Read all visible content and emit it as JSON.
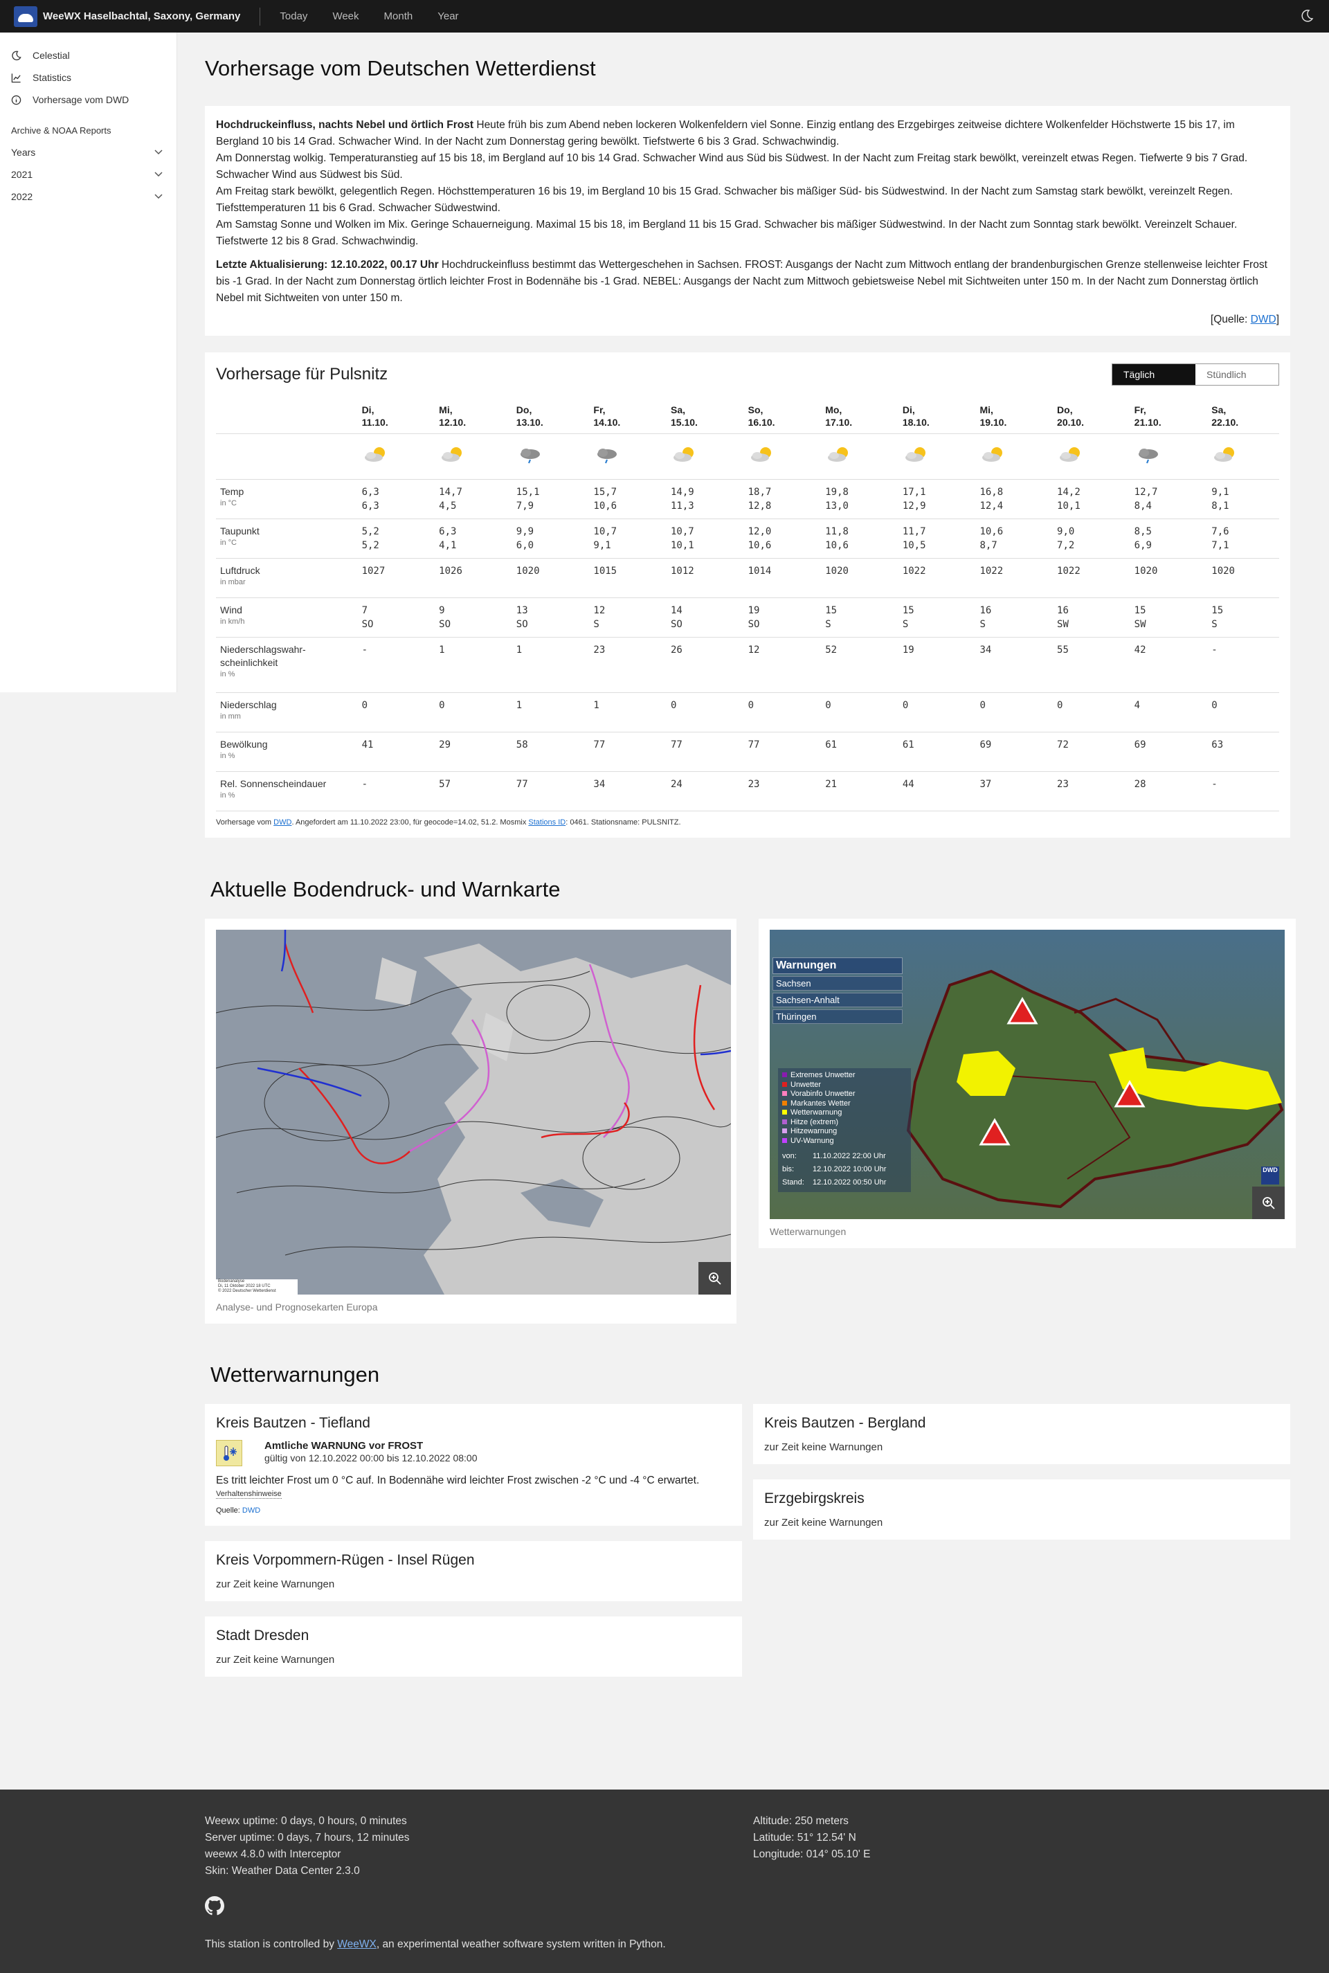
{
  "header": {
    "brand_prefix": "WeeWX",
    "brand_rest": "Haselbachtal, Saxony, Germany",
    "nav": [
      "Today",
      "Week",
      "Month",
      "Year"
    ]
  },
  "sidebar": {
    "items": [
      "Celestial",
      "Statistics",
      "Vorhersage vom DWD"
    ],
    "section": "Archive & NOAA Reports",
    "folds": [
      "Years",
      "2021",
      "2022"
    ]
  },
  "page_title": "Vorhersage vom Deutschen Wetterdienst",
  "text": {
    "lead1_bold": "Hochdruckeinfluss, nachts Nebel und örtlich Frost",
    "lead1": " Heute früh bis zum Abend neben lockeren Wolkenfeldern viel Sonne. Einzig entlang des Erzgebirges zeitweise dichtere Wolkenfelder Höchstwerte 15 bis 17, im Bergland 10 bis 14 Grad. Schwacher Wind. In der Nacht zum Donnerstag gering bewölkt. Tiefstwerte 6 bis 3 Grad. Schwachwindig.",
    "p2": "Am Donnerstag wolkig. Temperaturanstieg auf 15 bis 18, im Bergland auf 10 bis 14 Grad. Schwacher Wind aus Süd bis Südwest. In der Nacht zum Freitag stark bewölkt, vereinzelt etwas Regen. Tiefwerte 9 bis 7 Grad. Schwacher Wind aus Südwest bis Süd.",
    "p3": "Am Freitag stark bewölkt, gelegentlich Regen. Höchsttemperaturen 16 bis 19, im Bergland 10 bis 15 Grad. Schwacher bis mäßiger Süd- bis Südwestwind. In der Nacht zum Samstag stark bewölkt, vereinzelt Regen. Tiefsttemperaturen 11 bis 6 Grad. Schwacher Südwestwind.",
    "p4": "Am Samstag Sonne und Wolken im Mix. Geringe Schauerneigung. Maximal 15 bis 18, im Bergland 11 bis 15 Grad. Schwacher bis mäßiger Südwestwind. In der Nacht zum Sonntag stark bewölkt. Vereinzelt Schauer. Tiefstwerte 12 bis 8 Grad. Schwachwindig.",
    "lead2_bold": "Letzte Aktualisierung: 12.10.2022, 00.17 Uhr",
    "lead2": " Hochdruckeinfluss bestimmt das Wettergeschehen in Sachsen. FROST: Ausgangs der Nacht zum Mittwoch entlang der brandenburgischen Grenze stellenweise leichter Frost bis -1 Grad. In der Nacht zum Donnerstag örtlich leichter Frost in Bodennähe bis -1 Grad. NEBEL: Ausgangs der Nacht zum Mittwoch gebietsweise Nebel mit Sichtweiten unter 150 m. In der Nacht zum Donnerstag örtlich Nebel mit Sichtweiten von unter 150 m.",
    "source_pre": "[Quelle: ",
    "source_link": "DWD",
    "source_post": "]"
  },
  "forecast": {
    "title": "Vorhersage für Pulsnitz",
    "toggle": [
      "Täglich",
      "Stündlich"
    ],
    "days": [
      [
        "Di,",
        "11.10."
      ],
      [
        "Mi,",
        "12.10."
      ],
      [
        "Do,",
        "13.10."
      ],
      [
        "Fr,",
        "14.10."
      ],
      [
        "Sa,",
        "15.10."
      ],
      [
        "So,",
        "16.10."
      ],
      [
        "Mo,",
        "17.10."
      ],
      [
        "Di,",
        "18.10."
      ],
      [
        "Mi,",
        "19.10."
      ],
      [
        "Do,",
        "20.10."
      ],
      [
        "Fr,",
        "21.10."
      ],
      [
        "Sa,",
        "22.10."
      ]
    ],
    "icons": [
      "partly-cloudy",
      "partly-cloudy",
      "rain-cloud",
      "rain-cloud",
      "partly-cloudy",
      "partly-cloudy",
      "partly-cloudy",
      "partly-cloudy",
      "partly-cloudy",
      "partly-cloudy",
      "rain-cloud",
      "partly-cloudy"
    ],
    "rows": [
      {
        "label": "Temp",
        "unit": "in °C",
        "v": [
          [
            "6,3",
            "6,3"
          ],
          [
            "14,7",
            "4,5"
          ],
          [
            "15,1",
            "7,9"
          ],
          [
            "15,7",
            "10,6"
          ],
          [
            "14,9",
            "11,3"
          ],
          [
            "18,7",
            "12,8"
          ],
          [
            "19,8",
            "13,0"
          ],
          [
            "17,1",
            "12,9"
          ],
          [
            "16,8",
            "12,4"
          ],
          [
            "14,2",
            "10,1"
          ],
          [
            "12,7",
            "8,4"
          ],
          [
            "9,1",
            "8,1"
          ]
        ]
      },
      {
        "label": "Taupunkt",
        "unit": "in °C",
        "v": [
          [
            "5,2",
            "5,2"
          ],
          [
            "6,3",
            "4,1"
          ],
          [
            "9,9",
            "6,0"
          ],
          [
            "10,7",
            "9,1"
          ],
          [
            "10,7",
            "10,1"
          ],
          [
            "12,0",
            "10,6"
          ],
          [
            "11,8",
            "10,6"
          ],
          [
            "11,7",
            "10,5"
          ],
          [
            "10,6",
            "8,7"
          ],
          [
            "9,0",
            "7,2"
          ],
          [
            "8,5",
            "6,9"
          ],
          [
            "7,6",
            "7,1"
          ]
        ]
      },
      {
        "label": "Luftdruck",
        "unit": "in mbar",
        "v": [
          [
            "1027"
          ],
          [
            "1026"
          ],
          [
            "1020"
          ],
          [
            "1015"
          ],
          [
            "1012"
          ],
          [
            "1014"
          ],
          [
            "1020"
          ],
          [
            "1022"
          ],
          [
            "1022"
          ],
          [
            "1022"
          ],
          [
            "1020"
          ],
          [
            "1020"
          ]
        ]
      },
      {
        "label": "Wind",
        "unit": "in km/h",
        "v": [
          [
            "7",
            "SO"
          ],
          [
            "9",
            "SO"
          ],
          [
            "13",
            "SO"
          ],
          [
            "12",
            "S"
          ],
          [
            "14",
            "SO"
          ],
          [
            "19",
            "SO"
          ],
          [
            "15",
            "S"
          ],
          [
            "15",
            "S"
          ],
          [
            "16",
            "S"
          ],
          [
            "16",
            "SW"
          ],
          [
            "15",
            "SW"
          ],
          [
            "15",
            "S"
          ]
        ]
      },
      {
        "label": "Niederschlagswahr-scheinlichkeit",
        "unit": "in %",
        "v": [
          [
            "-"
          ],
          [
            "1"
          ],
          [
            "1"
          ],
          [
            "23"
          ],
          [
            "26"
          ],
          [
            "12"
          ],
          [
            "52"
          ],
          [
            "19"
          ],
          [
            "34"
          ],
          [
            "55"
          ],
          [
            "42"
          ],
          [
            "-"
          ]
        ]
      },
      {
        "label": "Niederschlag",
        "unit": "in mm",
        "v": [
          [
            "0"
          ],
          [
            "0"
          ],
          [
            "1"
          ],
          [
            "1"
          ],
          [
            "0"
          ],
          [
            "0"
          ],
          [
            "0"
          ],
          [
            "0"
          ],
          [
            "0"
          ],
          [
            "0"
          ],
          [
            "4"
          ],
          [
            "0"
          ]
        ]
      },
      {
        "label": "Bewölkung",
        "unit": "in %",
        "v": [
          [
            "41"
          ],
          [
            "29"
          ],
          [
            "58"
          ],
          [
            "77"
          ],
          [
            "77"
          ],
          [
            "77"
          ],
          [
            "61"
          ],
          [
            "61"
          ],
          [
            "69"
          ],
          [
            "72"
          ],
          [
            "69"
          ],
          [
            "63"
          ]
        ]
      },
      {
        "label": "Rel. Sonnenscheindauer",
        "unit": "in %",
        "v": [
          [
            "-"
          ],
          [
            "57"
          ],
          [
            "77"
          ],
          [
            "34"
          ],
          [
            "24"
          ],
          [
            "23"
          ],
          [
            "21"
          ],
          [
            "44"
          ],
          [
            "37"
          ],
          [
            "23"
          ],
          [
            "28"
          ],
          [
            "-"
          ]
        ]
      }
    ],
    "note_pre": "Vorhersage vom ",
    "note_dwd": "DWD",
    "note_mid": ". Angefordert am 11.10.2022 23:00, für geocode=14.02, 51.2. Mosmix ",
    "note_link": "Stations ID",
    "note_post": ": 0461. Stationsname: PULSNITZ."
  },
  "maps": {
    "title": "Aktuelle Bodendruck- und Warnkarte",
    "europe_caption": "Analyse- und Prognosekarten Europa",
    "europe_stamp": [
      "Bodenanalyse",
      "Di, 11 Oktober 2022 18 UTC",
      "© 2022 Deutscher Wetterdienst"
    ],
    "warn_caption": "Wetterwarnungen",
    "warn_panel_title": "Warnungen",
    "warn_regions": [
      "Sachsen",
      "Sachsen-Anhalt",
      "Thüringen"
    ],
    "legend": [
      "Extremes Unwetter",
      "Unwetter",
      "Vorabinfo Unwetter",
      "Markantes Wetter",
      "Wetterwarnung",
      "Hitze (extrem)",
      "Hitzewarnung",
      "UV-Warnung"
    ],
    "legend_colors": [
      "#8a1bb0",
      "#e02020",
      "#ff7fbf",
      "#f08000",
      "#ffff00",
      "#b05fd0",
      "#d8a0f0",
      "#c040ff"
    ],
    "times": [
      [
        "von:",
        "11.10.2022 22:00 Uhr"
      ],
      [
        "bis:",
        "12.10.2022 10:00 Uhr"
      ],
      [
        "Stand:",
        "12.10.2022 00:50 Uhr"
      ]
    ],
    "dwd_label": "DWD"
  },
  "warnings": {
    "title": "Wetterwarnungen",
    "left": [
      {
        "title": "Kreis Bautzen - Tiefland",
        "heading": "Amtliche WARNUNG vor FROST",
        "valid": "gültig von 12.10.2022 00:00 bis 12.10.2022 08:00",
        "text": "Es tritt leichter Frost um 0 °C auf. In Bodennähe wird leichter Frost zwischen -2 °C und -4 °C erwartet.",
        "hint": "Verhaltenshinweise",
        "source_pre": "Quelle: ",
        "source_link": "DWD"
      },
      {
        "title": "Kreis Vorpommern-Rügen - Insel Rügen",
        "none": "zur Zeit keine Warnungen"
      },
      {
        "title": "Stadt Dresden",
        "none": "zur Zeit keine Warnungen"
      }
    ],
    "right": [
      {
        "title": "Kreis Bautzen - Bergland",
        "none": "zur Zeit keine Warnungen"
      },
      {
        "title": "Erzgebirgskreis",
        "none": "zur Zeit keine Warnungen"
      }
    ]
  },
  "footer": {
    "left": [
      "Weewx uptime: 0 days, 0 hours, 0 minutes",
      "Server uptime: 0 days, 7 hours, 12 minutes",
      "weewx 4.8.0 with Interceptor",
      "Skin: Weather Data Center 2.3.0"
    ],
    "right": [
      "Altitude: 250 meters",
      "Latitude: 51° 12.54' N",
      "Longitude: 014° 05.10' E"
    ],
    "bottom_pre": "This station is controlled by ",
    "bottom_link": "WeeWX",
    "bottom_post": ", an experimental weather software system written in Python."
  }
}
